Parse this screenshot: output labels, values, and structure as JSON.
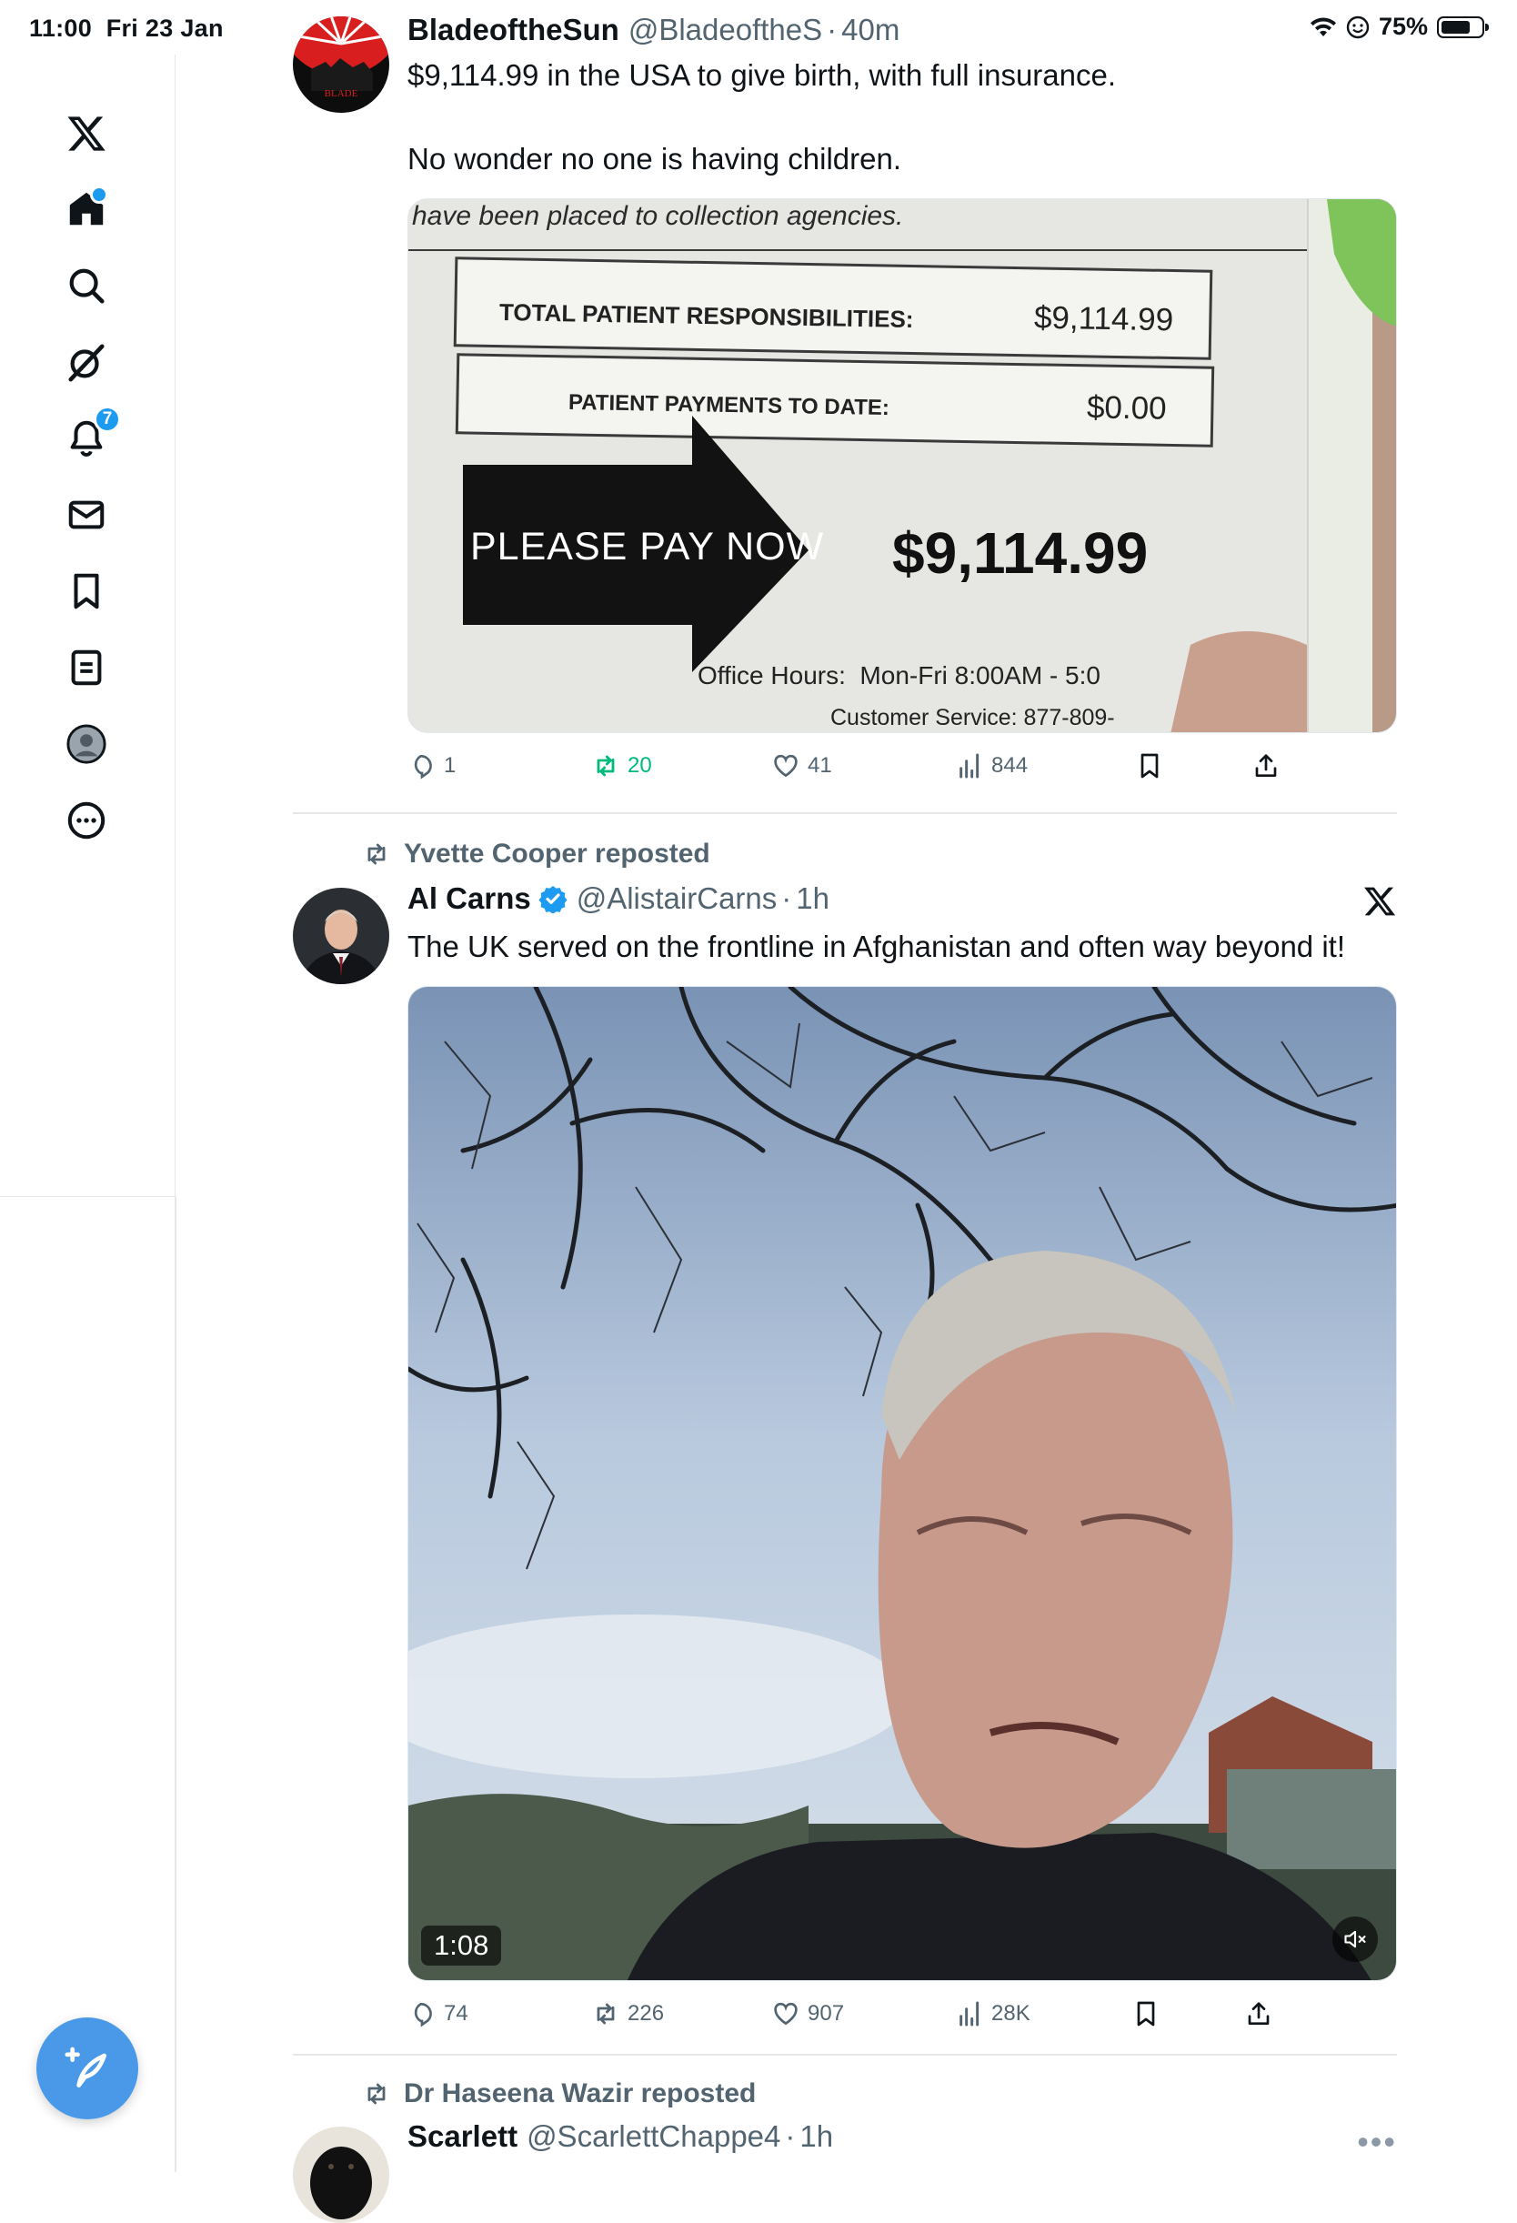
{
  "status_bar": {
    "time": "11:00",
    "date": "Fri 23 Jan",
    "battery": "75%",
    "battery_level": 0.75
  },
  "sidebar": {
    "items": [
      {
        "icon": "x-logo-icon"
      },
      {
        "icon": "home-icon",
        "label": "Home",
        "indicator": "dot"
      },
      {
        "icon": "search-icon",
        "label": "Explore"
      },
      {
        "icon": "grok-icon",
        "label": "Grok"
      },
      {
        "icon": "bell-icon",
        "label": "Notifications",
        "badge": "7"
      },
      {
        "icon": "mail-icon",
        "label": "Messages"
      },
      {
        "icon": "bookmark-icon",
        "label": "Bookmarks"
      },
      {
        "icon": "list-icon",
        "label": "Lists"
      },
      {
        "icon": "profile-icon",
        "label": "Profile"
      },
      {
        "icon": "more-icon",
        "label": "More"
      }
    ],
    "compose_icon": "compose-post-icon"
  },
  "tweets": [
    {
      "display_name": "BladeoftheSun",
      "handle": "@BladeoftheS",
      "age": "40m",
      "text": "$9,114.99 in the USA to give birth, with full insurance.\n\nNo wonder no one is having children.",
      "media": {
        "header": "have been placed to collection agencies.",
        "row1_label": "TOTAL PATIENT RESPONSIBILITIES:",
        "row1_value": "$9,114.99",
        "row2_label": "PATIENT PAYMENTS TO DATE:",
        "row2_value": "$0.00",
        "arrow_text": "PLEASE PAY NOW",
        "big_amount": "$9,114.99",
        "office_hours": "Office Hours:  Mon-Fri 8:00AM - 5:0",
        "customer_service": "Customer Service: 877-809-"
      },
      "replies": "1",
      "reposts": "20",
      "likes": "41",
      "views": "844",
      "reposted_by_me": true
    },
    {
      "reposted_by": "Yvette Cooper reposted",
      "display_name": "Al Carns",
      "handle": "@AlistairCarns",
      "age": "1h",
      "verified": true,
      "text": "The UK served on the frontline in Afghanistan and often way beyond it!",
      "media": {
        "video_time": "1:08"
      },
      "replies": "74",
      "reposts": "226",
      "likes": "907",
      "views": "28K"
    },
    {
      "reposted_by": "Dr Haseena Wazir reposted",
      "display_name": "Scarlett",
      "handle": "@ScarlettChappe4",
      "age": "1h"
    }
  ],
  "colors": {
    "accent": "#1d9bf0",
    "repost_green": "#00ba7c",
    "secondary_text": "#536471",
    "divider": "#e5e7eb"
  }
}
